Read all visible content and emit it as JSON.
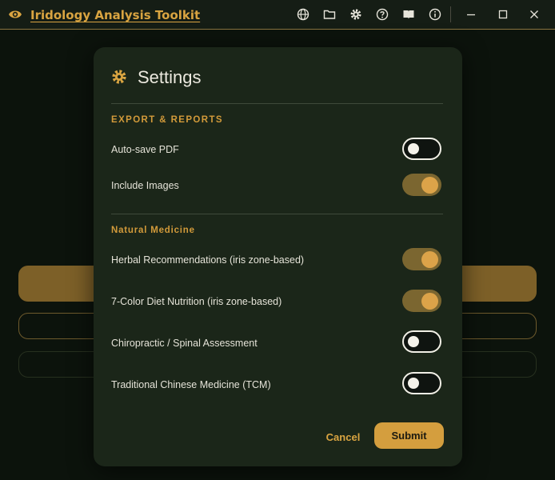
{
  "app": {
    "title": "Iridology Analysis Toolkit",
    "accent_color": "#d9a441"
  },
  "titlebar": {
    "icons": [
      "globe-icon",
      "folder-icon",
      "gear-icon",
      "help-icon",
      "book-icon",
      "info-icon"
    ],
    "window_controls": [
      "minimize-icon",
      "maximize-icon",
      "close-icon"
    ]
  },
  "dialog": {
    "title": "Settings",
    "icon": "gear-icon",
    "sections": [
      {
        "title": "EXPORT & REPORTS",
        "rows": [
          {
            "label": "Auto-save PDF",
            "enabled": false
          },
          {
            "label": "Include Images",
            "enabled": true
          }
        ]
      },
      {
        "title": "Natural Medicine",
        "rows": [
          {
            "label": "Herbal Recommendations (iris zone-based)",
            "enabled": true
          },
          {
            "label": "7-Color Diet Nutrition (iris zone-based)",
            "enabled": true
          },
          {
            "label": "Chiropractic / Spinal Assessment",
            "enabled": false
          },
          {
            "label": "Traditional Chinese Medicine (TCM)",
            "enabled": false
          }
        ]
      }
    ],
    "cancel_label": "Cancel",
    "submit_label": "Submit"
  }
}
